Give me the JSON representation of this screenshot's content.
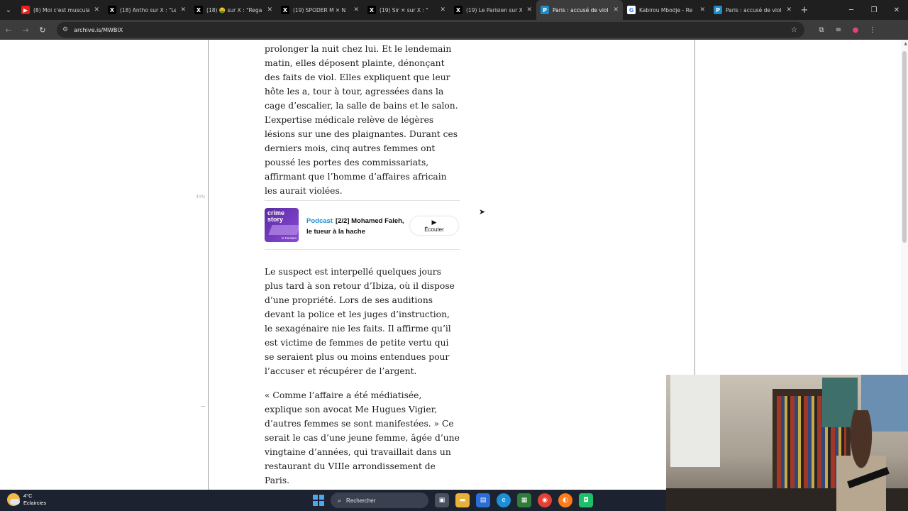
{
  "tabs": [
    {
      "title": "(8) Moi c'est muscula",
      "favicon": "youtube-icon",
      "color": "#e62117"
    },
    {
      "title": "(18) Antho sur X : \"Le",
      "favicon": "x-icon",
      "color": "#000000"
    },
    {
      "title": "(18) 🤑 sur X : \"Rega",
      "favicon": "x-icon",
      "color": "#000000"
    },
    {
      "title": "(19) SPODER M ✕ N",
      "favicon": "x-icon",
      "color": "#000000"
    },
    {
      "title": "(19) Sir ✕ sur X : \"",
      "favicon": "x-icon",
      "color": "#000000"
    },
    {
      "title": "(19) Le Parisien sur X",
      "favicon": "x-icon",
      "color": "#000000"
    },
    {
      "title": "Paris : accusé de viol",
      "favicon": "parisien-icon",
      "color": "#1d8ac9",
      "active": true
    },
    {
      "title": "Kabirou Mbodje - Re",
      "favicon": "google-icon",
      "color": "#ffffff"
    },
    {
      "title": "Paris : accusé de viol",
      "favicon": "parisien-icon",
      "color": "#1d8ac9"
    }
  ],
  "address_bar": {
    "url": "archive.is/MWBIX"
  },
  "side_marker": {
    "percent": "40%"
  },
  "article": {
    "para1": "prolonger la nuit chez lui. Et le lendemain matin, elles déposent plainte, dénonçant des faits de viol. Elles expliquent que leur hôte les a, tour à tour, agressées dans la cage d’escalier, la salle de bains et le salon. L’expertise médicale relève de légères lésions sur une des plaignantes. Durant ces derniers mois, cinq autres femmes ont poussé les portes des commissariats, affirmant que l’homme d’affaires africain les aurait violées.",
    "para2": "Le suspect est interpellé quelques jours plus tard à son retour d’Ibiza, où il dispose d’une propriété. Lors de ses auditions devant la police et les juges d’instruction, le sexagénaire nie les faits. Il affirme qu’il est victime de femmes de petite vertu qui se seraient plus ou moins entendues pour l’accuser et récupérer de l’argent.",
    "para3": "« Comme l’affaire a été médiatisée, explique son avocat Me Hugues Vigier, d’autres femmes se sont manifestées. » Ce serait le cas d’une jeune femme, âgée d’une vingtaine d’années, qui travaillait dans un restaurant du VIIIe arrondissement de Paris."
  },
  "podcast": {
    "thumb_line1": "crime",
    "thumb_line2": "story",
    "thumb_pub": "le Parisien",
    "tag": "Podcast",
    "title": "[2/2] Mohamed Faleh, le tueur à la hache",
    "button_label": "Écouter"
  },
  "taskbar": {
    "temperature": "4°C",
    "weather": "Eclaircies",
    "search_placeholder": "Rechercher"
  }
}
